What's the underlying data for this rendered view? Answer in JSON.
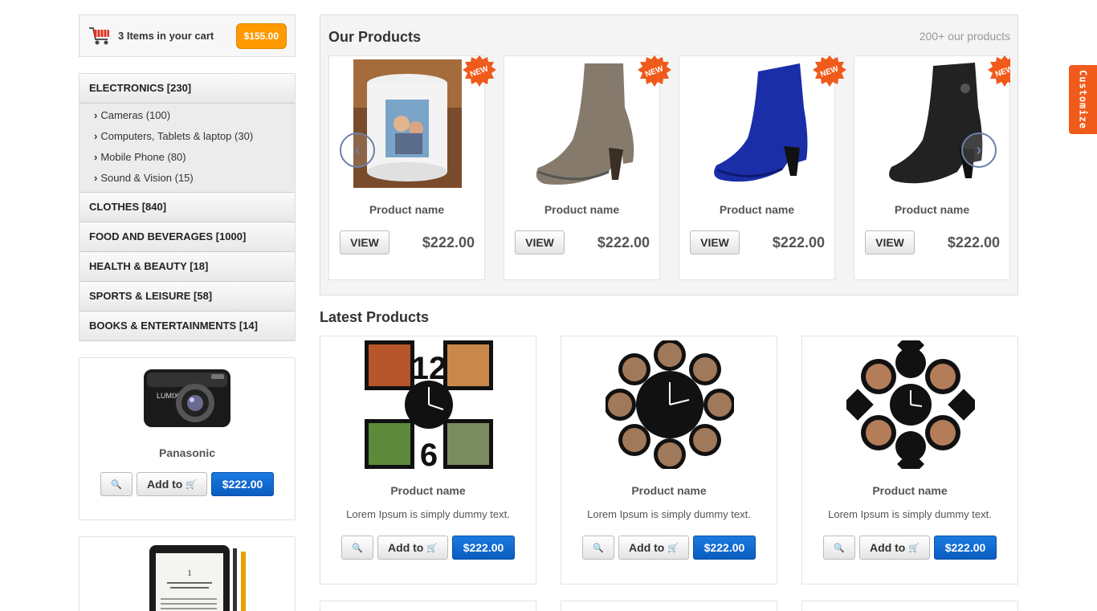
{
  "cart": {
    "text": "3 Items in your cart",
    "total": "$155.00"
  },
  "categories": {
    "electronics": "ELECTRONICS [230]",
    "electronics_sub": [
      "Cameras (100)",
      "Computers, Tablets & laptop (30)",
      "Mobile Phone (80)",
      "Sound & Vision (15)"
    ],
    "others": [
      "CLOTHES [840]",
      "FOOD AND BEVERAGES [1000]",
      "HEALTH & BEAUTY [18]",
      "SPORTS & LEISURE [58]",
      "BOOKS & ENTERTAINMENTS [14]"
    ]
  },
  "side_product": {
    "name": "Panasonic",
    "add_label": "Add to",
    "price": "$222.00"
  },
  "our_products": {
    "title": "Our Products",
    "count": "200+ our products",
    "badge": "NEW",
    "items": [
      {
        "name": "Product name",
        "view": "VIEW",
        "price": "$222.00"
      },
      {
        "name": "Product name",
        "view": "VIEW",
        "price": "$222.00"
      },
      {
        "name": "Product name",
        "view": "VIEW",
        "price": "$222.00"
      },
      {
        "name": "Product name",
        "view": "VIEW",
        "price": "$222.00"
      }
    ]
  },
  "latest": {
    "title": "Latest Products",
    "items": [
      {
        "name": "Product name",
        "desc": "Lorem Ipsum is simply dummy text.",
        "add_label": "Add to",
        "price": "$222.00"
      },
      {
        "name": "Product name",
        "desc": "Lorem Ipsum is simply dummy text.",
        "add_label": "Add to",
        "price": "$222.00"
      },
      {
        "name": "Product name",
        "desc": "Lorem Ipsum is simply dummy text.",
        "add_label": "Add to",
        "price": "$222.00"
      }
    ]
  },
  "customize_label": "Customize",
  "colors": {
    "cart_total": "#ff9900",
    "price_button": "#0b5cc0",
    "badge": "#f05a1a",
    "customize_tab": "#f05a1a"
  }
}
